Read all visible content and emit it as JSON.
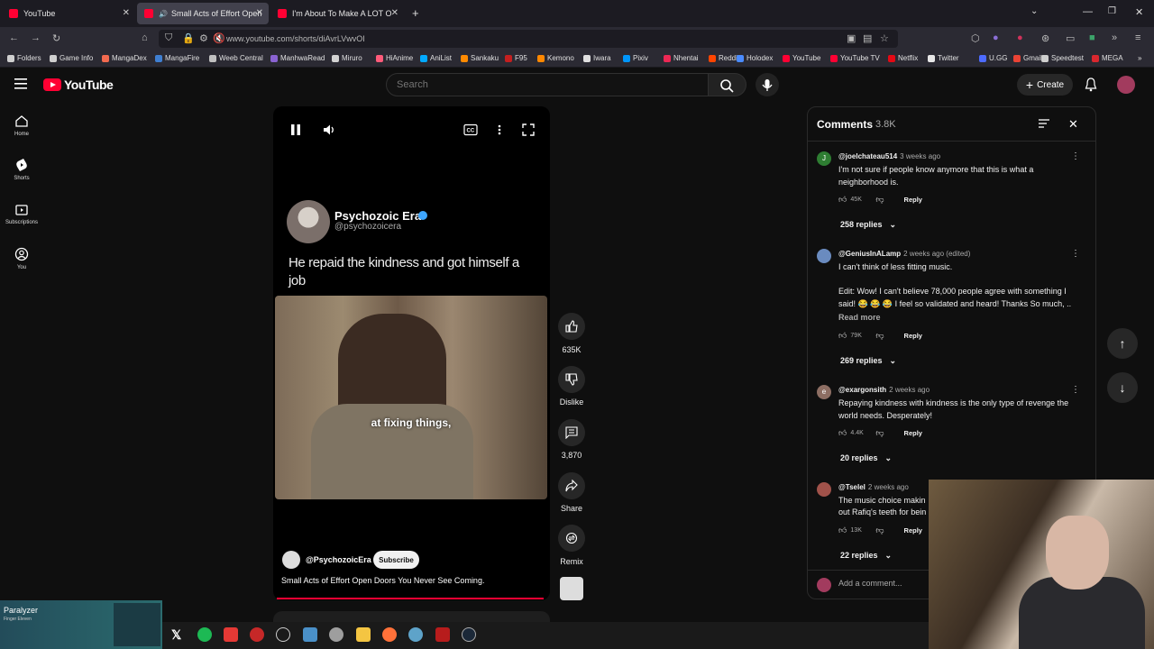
{
  "tabs": [
    {
      "title": "YouTube",
      "active": false
    },
    {
      "title": "Small Acts of Effort Open D",
      "active": true
    },
    {
      "title": "I'm About To Make A LOT Of Pe",
      "active": false
    }
  ],
  "url": "www.youtube.com/shorts/diAvrLVwvOI",
  "bookmarks": [
    {
      "label": "Folders",
      "color": "#cfcfcf"
    },
    {
      "label": "Game Info",
      "color": "#cfcfcf"
    },
    {
      "label": "MangaDex",
      "color": "#f26a4f"
    },
    {
      "label": "MangaFire",
      "color": "#3f7fd1"
    },
    {
      "label": "Weeb Central",
      "color": "#c0c0c0"
    },
    {
      "label": "ManhwaRead",
      "color": "#8a63d2"
    },
    {
      "label": "Miruro",
      "color": "#d2d2d2"
    },
    {
      "label": "HiAnime",
      "color": "#ff5b7a"
    },
    {
      "label": "AniList",
      "color": "#02a9ff"
    },
    {
      "label": "Sankaku",
      "color": "#ff8a00"
    },
    {
      "label": "F95",
      "color": "#c41f1f"
    },
    {
      "label": "Kemono",
      "color": "#ff8800"
    },
    {
      "label": "Iwara",
      "color": "#e0e0e0"
    },
    {
      "label": "Pixiv",
      "color": "#0096fa"
    },
    {
      "label": "Nhentai",
      "color": "#ec2854"
    },
    {
      "label": "Reddit",
      "color": "#ff4500"
    },
    {
      "label": "Holodex",
      "color": "#4a8bff"
    },
    {
      "label": "YouTube",
      "color": "#ff0033"
    },
    {
      "label": "YouTube TV",
      "color": "#ff0033"
    },
    {
      "label": "Netflix",
      "color": "#e50914"
    },
    {
      "label": "Twitter",
      "color": "#e7e7e7"
    },
    {
      "label": "U.GG",
      "color": "#4d6bff"
    },
    {
      "label": "Gmail",
      "color": "#ea4335"
    },
    {
      "label": "Speedtest",
      "color": "#cfcfcf"
    },
    {
      "label": "MEGA",
      "color": "#d9272e"
    }
  ],
  "header": {
    "logo": "YouTube",
    "search_placeholder": "Search",
    "create_label": "Create"
  },
  "left_nav": [
    {
      "label": "Home",
      "icon": "home-icon"
    },
    {
      "label": "Shorts",
      "icon": "shorts-icon"
    },
    {
      "label": "Subscriptions",
      "icon": "subscriptions-icon"
    },
    {
      "label": "You",
      "icon": "you-icon"
    }
  ],
  "video": {
    "channel_name": "Psychozoic Era",
    "channel_handle": "@psychozoicera",
    "caption": "He repaid the kindness and got himself a job",
    "subtitle": "at fixing things,",
    "owner": "@PsychozoicEra",
    "subscribe_label": "Subscribe",
    "description": "Small Acts of Effort Open Doors You Never See Coming.",
    "progress": 0.98
  },
  "actions": {
    "likes": "635K",
    "dislike_label": "Dislike",
    "comments": "3,870",
    "share_label": "Share",
    "remix_label": "Remix"
  },
  "comments": {
    "title": "Comments",
    "count": "3.8K",
    "reply_label": "Reply",
    "read_more": "Read more",
    "add_placeholder": "Add a comment...",
    "items": [
      {
        "author": "@joelchateau514",
        "date": "3 weeks ago",
        "text": "I'm not sure if people know anymore that this is what a neighborhood is.",
        "likes": "45K",
        "replies": "258 replies",
        "avatar_color": "#2e7d32",
        "initial": "J"
      },
      {
        "author": "@GeniusInALamp",
        "date": "2 weeks ago (edited)",
        "text": "I can't think of less fitting music.",
        "text2": "Edit: Wow! I can't believe 78,000 people agree with something I said! 😂 😂 😂  I feel so validated and heard! Thanks So much, ..",
        "likes": "79K",
        "replies": "269 replies",
        "avatar_color": "#6a8bbf",
        "initial": ""
      },
      {
        "author": "@exargonsith",
        "date": "2 weeks ago",
        "text": "Repaying kindness with kindness is the only type of revenge the world needs. Desperately!",
        "likes": "4.4K",
        "replies": "20 replies",
        "avatar_color": "#8d6e63",
        "initial": "e"
      },
      {
        "author": "@Tselel",
        "date": "2 weeks ago",
        "text": "The music choice makin",
        "text2": "out Rafiq's teeth for bein",
        "likes": "13K",
        "replies": "22 replies",
        "avatar_color": "#a0524a",
        "initial": ""
      }
    ]
  },
  "music_overlay": {
    "title": "Paralyzer",
    "artist": "Finger Eleven"
  }
}
